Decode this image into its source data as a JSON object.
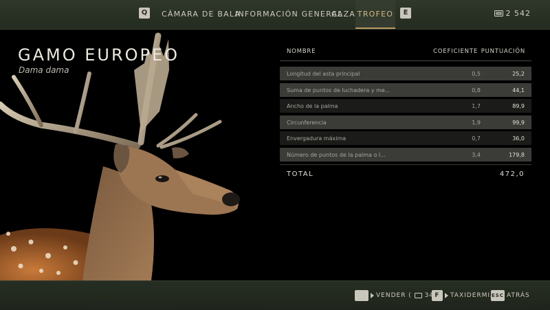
{
  "topbar": {
    "prev_key": "Q",
    "next_key": "E",
    "tabs": [
      {
        "label": "CÁMARA DE BALA"
      },
      {
        "label": "INFORMACIÓN GENERAL"
      },
      {
        "label": "CAZA"
      },
      {
        "label": "TROFEO"
      }
    ],
    "active_tab": "TROFEO",
    "currency_value": "2 542",
    "currency_icon": "money-icon"
  },
  "animal": {
    "name": "GAMO EUROPEO",
    "latin_name": "Dama dama"
  },
  "trophy_table": {
    "headers": {
      "name": "NOMBRE",
      "coefficient": "COEFICIENTE",
      "score": "PUNTUACIÓN"
    },
    "rows": [
      {
        "name": "Longitud del asta principal",
        "coefficient": "0,5",
        "score": "25,2"
      },
      {
        "name": "Suma de puntos de luchadera y me...",
        "coefficient": "0,8",
        "score": "44,1"
      },
      {
        "name": "Ancho de la palma",
        "coefficient": "1,7",
        "score": "89,9"
      },
      {
        "name": "Circunferencia",
        "coefficient": "1,9",
        "score": "99,9"
      },
      {
        "name": "Envergadura máxima",
        "coefficient": "0,7",
        "score": "36,0"
      },
      {
        "name": "Número de puntos de la palma o l...",
        "coefficient": "3,4",
        "score": "179,8"
      }
    ],
    "total_label": "TOTAL",
    "total_value": "472,0"
  },
  "actions": {
    "sell_key": "",
    "sell_label": "VENDER (",
    "sell_price": "341)",
    "taxidermy_key": "F",
    "taxidermy_label": "TAXIDERMIA",
    "back_key": "ESC",
    "back_label": "ATRÁS"
  },
  "colors": {
    "accent": "#d9b87a",
    "bar": "#2f382a"
  }
}
